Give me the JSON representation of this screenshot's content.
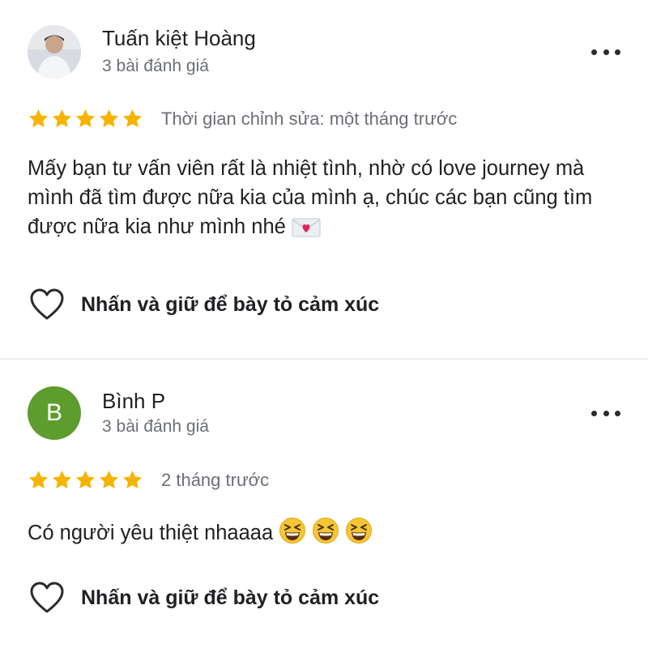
{
  "reviews": [
    {
      "author": "Tuấn kiệt Hoàng",
      "review_count": "3 bài đánh giá",
      "avatar_type": "photo",
      "rating": 5,
      "time": "Thời gian chỉnh sửa: một tháng trước",
      "text": "Mấy bạn tư vấn viên rất là nhiệt tình, nhờ có love journey mà mình đã tìm được nữa kia của mình ạ, chúc các bạn cũng tìm được nữa kia như mình nhé",
      "emoji_icons": [
        "love-letter-icon"
      ],
      "react_label": "Nhấn và giữ để bày tỏ cảm xúc"
    },
    {
      "author": "Bình P",
      "review_count": "3 bài đánh giá",
      "avatar_type": "letter",
      "avatar_letter": "B",
      "avatar_color": "#5e9c2e",
      "rating": 5,
      "time": "2 tháng trước",
      "text": "Có người yêu thiệt nhaaaa",
      "emoji_icons": [
        "grinning-squinting-face-icon",
        "grinning-squinting-face-icon",
        "grinning-squinting-face-icon"
      ],
      "react_label": "Nhấn và giữ để bày tỏ cảm xúc"
    }
  ],
  "colors": {
    "star": "#f5b400",
    "text_primary": "#202124",
    "text_secondary": "#6b6f75",
    "divider": "#ececec"
  }
}
